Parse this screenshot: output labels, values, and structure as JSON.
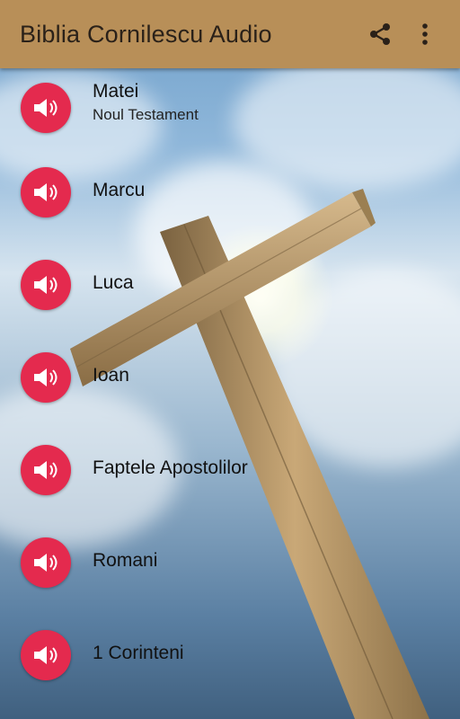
{
  "app": {
    "title": "Biblia Cornilescu Audio"
  },
  "toolbar": {
    "share_icon": "share-icon",
    "menu_icon": "more-vert-icon"
  },
  "colors": {
    "appbar": "#b88f58",
    "accent": "#e42a4e"
  },
  "items": [
    {
      "title": "Matei",
      "subtitle": "Noul Testament",
      "icon": "speaker-icon"
    },
    {
      "title": "Marcu",
      "icon": "speaker-icon"
    },
    {
      "title": "Luca",
      "icon": "speaker-icon"
    },
    {
      "title": "Ioan",
      "icon": "speaker-icon"
    },
    {
      "title": "Faptele Apostolilor",
      "icon": "speaker-icon"
    },
    {
      "title": "Romani",
      "icon": "speaker-icon"
    },
    {
      "title": "1 Corinteni",
      "icon": "speaker-icon"
    }
  ]
}
